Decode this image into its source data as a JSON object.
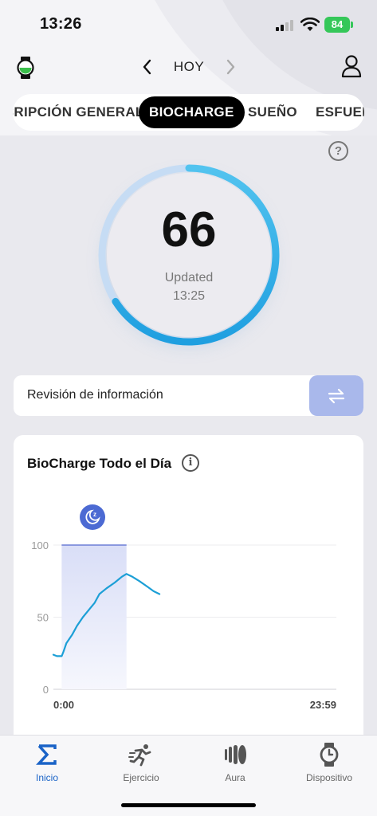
{
  "status_bar": {
    "time": "13:26",
    "battery": "84"
  },
  "header": {
    "title": "HOY"
  },
  "tabs": [
    {
      "label": "DESCRIPCIÓN GENERAL"
    },
    {
      "label": "BIOCHARGE"
    },
    {
      "label": "SUEÑO"
    },
    {
      "label": "ESFUERZO"
    }
  ],
  "gauge": {
    "value": "66",
    "updated_label": "Updated",
    "updated_time": "13:25",
    "fraction": 0.66
  },
  "info_card": {
    "label": "Revisión de información"
  },
  "chart_card": {
    "title": "BioCharge Todo el Día",
    "info_icon": "i"
  },
  "chart_data": {
    "type": "line",
    "title": "BioCharge Todo el Día",
    "x_ticks": [
      "0:00",
      "23:59"
    ],
    "y_ticks": [
      "100",
      "50",
      "0"
    ],
    "ylim": [
      0,
      100
    ],
    "sleep_marker": "moon-icon",
    "series": [
      {
        "points": [
          [
            0.0,
            24
          ],
          [
            0.3,
            23
          ],
          [
            0.7,
            23
          ],
          [
            0.85,
            26
          ],
          [
            1.1,
            32
          ],
          [
            1.6,
            38
          ],
          [
            2.0,
            44
          ],
          [
            2.5,
            50
          ],
          [
            3.0,
            55
          ],
          [
            3.5,
            60
          ],
          [
            3.9,
            66
          ],
          [
            4.5,
            70
          ],
          [
            5.2,
            74
          ],
          [
            5.8,
            78
          ],
          [
            6.2,
            80
          ],
          [
            6.7,
            78
          ],
          [
            7.3,
            75
          ],
          [
            8.0,
            71
          ],
          [
            8.5,
            68
          ],
          [
            9.0,
            66
          ]
        ]
      }
    ],
    "sleep_band": {
      "start": 0.7,
      "end": 6.2,
      "level": 100
    }
  },
  "tabbar": [
    {
      "label": "Inicio",
      "icon": "sigma-icon"
    },
    {
      "label": "Ejercicio",
      "icon": "running-icon"
    },
    {
      "label": "Aura",
      "icon": "aura-icon"
    },
    {
      "label": "Dispositivo",
      "icon": "watch-icon"
    }
  ],
  "colors": {
    "accent": "#29a8e3",
    "active_tab": "#1a63c7",
    "gauge_track": "#c6dcf4",
    "info_button": "#a9b8eb"
  }
}
